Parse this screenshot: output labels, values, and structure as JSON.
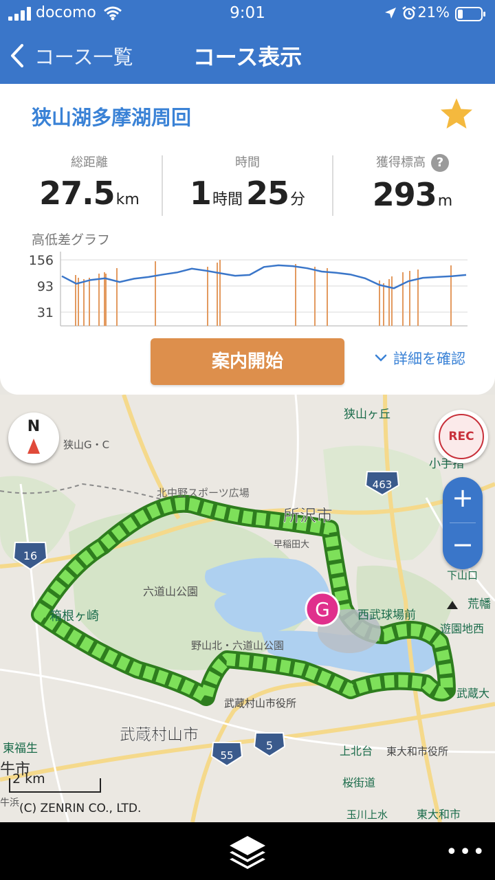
{
  "status_bar": {
    "carrier": "docomo",
    "time": "9:01",
    "battery_percent": "21%"
  },
  "nav": {
    "back_label": "コース一覧",
    "title": "コース表示"
  },
  "course": {
    "name": "狭山湖多摩湖周回",
    "favorite": true,
    "stats": {
      "distance": {
        "label": "総距離",
        "value": "27.5",
        "unit": "km"
      },
      "time": {
        "label": "時間",
        "hours": "1",
        "hours_unit": "時間",
        "minutes": "25",
        "minutes_unit": "分"
      },
      "elevation_gain": {
        "label": "獲得標高",
        "value": "293",
        "unit": "m",
        "help": "?"
      }
    }
  },
  "elevation_graph": {
    "label": "高低差グラフ",
    "y_ticks": [
      "156",
      "93",
      "31"
    ]
  },
  "actions": {
    "start_label": "案内開始",
    "details_label": "詳細を確認"
  },
  "map": {
    "compass_label": "N",
    "rec_label": "REC",
    "zoom_in": "+",
    "zoom_out": "−",
    "goal_marker": "G",
    "scale_label": "2 km",
    "copyright": "(C) ZENRIN CO., LTD.",
    "places": [
      "狭山ヶ丘",
      "狭山G・C",
      "北中野スポーツ広場",
      "所沢市",
      "早稲田大",
      "六道山公園",
      "野山北・六道山公園",
      "箱根ヶ崎",
      "西武球場前",
      "遊園地西",
      "武蔵大",
      "下山口",
      "荒幡",
      "小手指",
      "武蔵村山市役所",
      "武蔵村山市",
      "東福生",
      "上北台",
      "東大和市役所",
      "桜街道",
      "玉川上水",
      "東大和市",
      "牛市",
      "牛浜"
    ],
    "route_shields": [
      "16",
      "463",
      "5",
      "55"
    ]
  },
  "chart_data": {
    "type": "area",
    "title": "高低差グラフ",
    "ylim": [
      31,
      156
    ],
    "y_ticks": [
      156,
      93,
      31
    ],
    "x": [
      0,
      1,
      2,
      3,
      4,
      5,
      6,
      7,
      8,
      9,
      10,
      11,
      12,
      13,
      14,
      15,
      16,
      17,
      18,
      19,
      20,
      21,
      22,
      23,
      24,
      25,
      26,
      27,
      28
    ],
    "series": [
      {
        "values": [
          117,
          99,
          108,
          112,
          103,
          111,
          115,
          121,
          126,
          135,
          130,
          124,
          118,
          120,
          139,
          143,
          141,
          136,
          128,
          125,
          121,
          112,
          96,
          88,
          105,
          113,
          115,
          117,
          120
        ]
      }
    ]
  },
  "colors": {
    "header_blue": "#3a76c9",
    "title_blue": "#3a82d6",
    "start_orange": "#dd8f4c",
    "rec_red": "#c8303a",
    "route_green": "#7ee05a",
    "goal_pink": "#e0308c",
    "star_yellow": "#f4b93e"
  }
}
